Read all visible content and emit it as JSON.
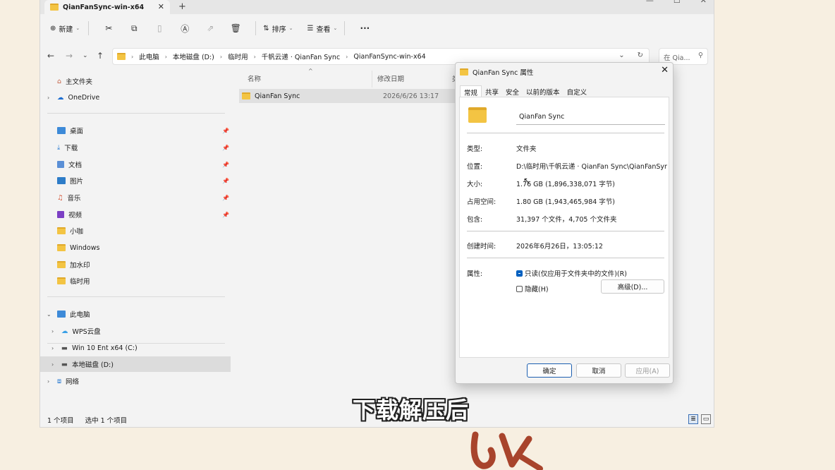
{
  "window": {
    "tab_title": "QianFanSync-win-x64",
    "tab_close": "✕",
    "new_tab": "+"
  },
  "commandbar": {
    "new_label": "新建",
    "sort_label": "排序",
    "view_label": "查看",
    "more": "···"
  },
  "address": {
    "crumbs": [
      "此电脑",
      "本地磁盘 (D:)",
      "临时用",
      "千帆云递 · QianFan Sync",
      "QianFanSync-win-x64"
    ],
    "search_placeholder": "在 Qia..."
  },
  "sidebar": {
    "home": "主文件夹",
    "onedrive": "OneDrive",
    "pinned": [
      "桌面",
      "下载",
      "文档",
      "图片",
      "音乐",
      "视频"
    ],
    "folders": [
      "小咖",
      "Windows",
      "加水印",
      "临时用"
    ],
    "this_pc": "此电脑",
    "wps": "WPS云盘",
    "drive_c": "Win 10 Ent x64 (C:)",
    "drive_d": "本地磁盘 (D:)",
    "network": "网络"
  },
  "filelist": {
    "col_name": "名称",
    "col_date": "修改日期",
    "col_type_partial": "类",
    "rows": [
      {
        "name": "QianFan Sync",
        "date": "2026/6/26 13:17"
      }
    ]
  },
  "statusbar": {
    "count": "1 个项目",
    "selected": "选中 1 个项目"
  },
  "dialog": {
    "title": "QianFan Sync 属性",
    "close": "✕",
    "tabs": [
      "常规",
      "共享",
      "安全",
      "以前的版本",
      "自定义"
    ],
    "name_value": "QianFan Sync",
    "type_label": "类型:",
    "type_value": "文件夹",
    "location_label": "位置:",
    "location_value": "D:\\临时用\\千帆云递 · QianFan Sync\\QianFanSync-w",
    "size_label": "大小:",
    "size_value": "1.76 GB (1,896,338,071 字节)",
    "disk_label": "占用空间:",
    "disk_value": "1.80 GB (1,943,465,984 字节)",
    "contains_label": "包含:",
    "contains_value": "31,397 个文件，4,705 个文件夹",
    "created_label": "创建时间:",
    "created_value": "2026年6月26日，13:05:12",
    "attrs_label": "属性:",
    "readonly_label": "只读(仅应用于文件夹中的文件)(R)",
    "hidden_label": "隐藏(H)",
    "advanced_label": "高级(D)...",
    "ok_label": "确定",
    "cancel_label": "取消",
    "apply_label": "应用(A)"
  },
  "overlay": {
    "subtitle": "下载解压后"
  },
  "colors": {
    "accent": "#0060c0",
    "folder": "#f3c443"
  }
}
